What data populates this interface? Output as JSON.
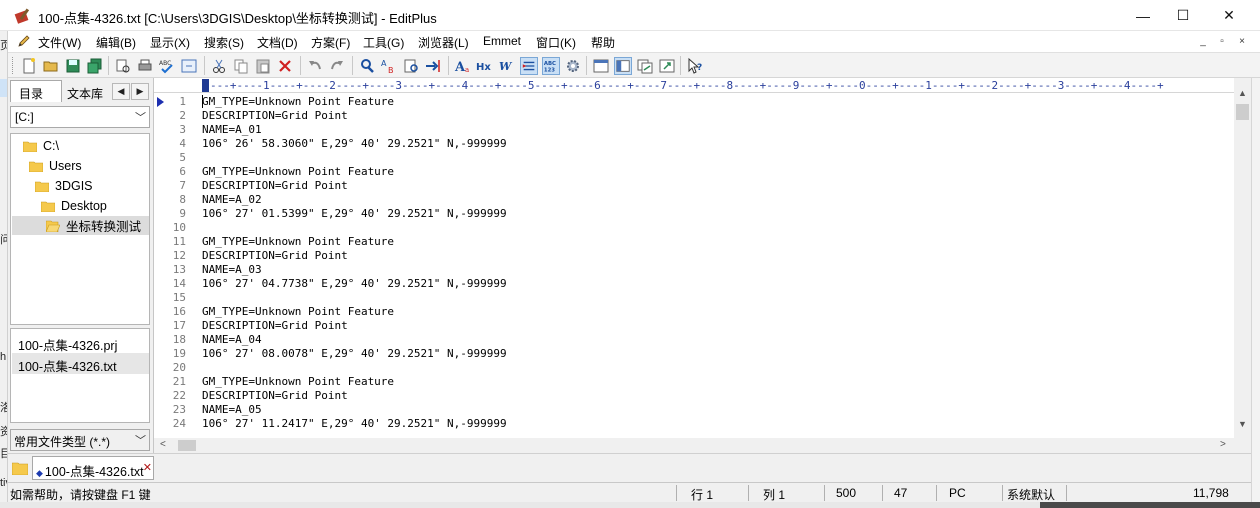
{
  "window": {
    "title": "100-点集-4326.txt [C:\\Users\\3DGIS\\Desktop\\坐标转换测试] - EditPlus",
    "minimize_glyph": "—",
    "maximize_glyph": "☐",
    "close_glyph": "✕"
  },
  "left_edge_chars": [
    "页",
    "问",
    "h",
    "洛",
    "资",
    "目",
    "tiv"
  ],
  "menu": {
    "items": [
      "文件(W)",
      "编辑(B)",
      "显示(X)",
      "搜索(S)",
      "文档(D)",
      "方案(F)",
      "工具(G)",
      "浏览器(L)",
      "Emmet",
      "窗口(K)",
      "帮助"
    ],
    "mdi_buttons": [
      "_",
      "▫",
      "×"
    ]
  },
  "toolbar": {
    "icons": [
      "new-file-icon",
      "open-folder-icon",
      "save-icon",
      "save-all-icon",
      "print-preview-icon",
      "print-icon",
      "spell-check-icon",
      "browser-preview-icon",
      "cut-icon",
      "copy-icon",
      "paste-icon",
      "delete-icon",
      "undo-icon",
      "redo-icon",
      "find-icon",
      "replace-icon",
      "find-in-files-icon",
      "goto-icon",
      "font-icon",
      "hex-icon",
      "word-wrap-icon",
      "line-number-icon",
      "ruler-icon",
      "settings-icon",
      "window-list-icon",
      "tile-icon",
      "cascade-icon",
      "fullscreen-icon",
      "help-icon"
    ],
    "active_icons": [
      "line-number-icon",
      "ruler-icon",
      "tile-icon"
    ]
  },
  "left_panel": {
    "tab_directory": "目录",
    "tab_library": "文本库",
    "nav_prev": "◀",
    "nav_next": "▶",
    "drive": "[C:]",
    "tree": [
      "C:\\",
      "Users",
      "3DGIS",
      "Desktop",
      "坐标转换测试"
    ],
    "files": [
      "100-点集-4326.prj",
      "100-点集-4326.txt"
    ],
    "file_type": "常用文件类型 (*.*)"
  },
  "ruler": {
    "text": "---+----1----+----2----+----3----+----4----+----5----+----6----+----7----+----8----+----9----+----0----+----1----+----2----+----3----+----4----+"
  },
  "editor": {
    "line_numbers": [
      "1",
      "2",
      "3",
      "4",
      "5",
      "6",
      "7",
      "8",
      "9",
      "10",
      "11",
      "12",
      "13",
      "14",
      "15",
      "16",
      "17",
      "18",
      "19",
      "20",
      "21",
      "22",
      "23",
      "24"
    ],
    "lines": [
      "GM_TYPE=Unknown Point Feature",
      "DESCRIPTION=Grid Point",
      "NAME=A_01",
      "106° 26' 58.3060\" E,29° 40' 29.2521\" N,-999999",
      "",
      "GM_TYPE=Unknown Point Feature",
      "DESCRIPTION=Grid Point",
      "NAME=A_02",
      "106° 27' 01.5399\" E,29° 40' 29.2521\" N,-999999",
      "",
      "GM_TYPE=Unknown Point Feature",
      "DESCRIPTION=Grid Point",
      "NAME=A_03",
      "106° 27' 04.7738\" E,29° 40' 29.2521\" N,-999999",
      "",
      "GM_TYPE=Unknown Point Feature",
      "DESCRIPTION=Grid Point",
      "NAME=A_04",
      "106° 27' 08.0078\" E,29° 40' 29.2521\" N,-999999",
      "",
      "GM_TYPE=Unknown Point Feature",
      "DESCRIPTION=Grid Point",
      "NAME=A_05",
      "106° 27' 11.2417\" E,29° 40' 29.2521\" N,-999999"
    ]
  },
  "doc_tab": {
    "mod_mark": "◆",
    "label": "100-点集-4326.txt",
    "close": "✕"
  },
  "status": {
    "help": "如需帮助，请按键盘 F1 键",
    "row": "行 1",
    "col": "列 1",
    "total_lines": "500",
    "chars": "47",
    "format": "PC",
    "encoding": "系统默认",
    "size": "11,798"
  },
  "colors": {
    "accent": "#1d2fb0",
    "ruler": "#2a3f9c",
    "line_number": "#7a7a7a"
  }
}
